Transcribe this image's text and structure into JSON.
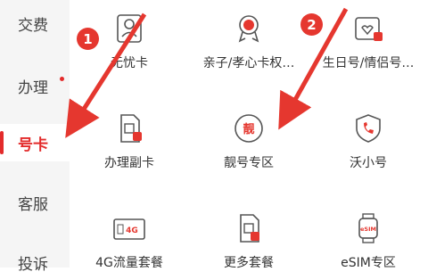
{
  "sidebar": {
    "items": [
      {
        "label": "交费"
      },
      {
        "label": "办理"
      },
      {
        "label": "号卡"
      },
      {
        "label": "客服"
      },
      {
        "label": "投诉"
      }
    ]
  },
  "grid": [
    {
      "label": "无忧卡",
      "icon": "person-card-icon"
    },
    {
      "label": "亲子/孝心卡权…",
      "icon": "family-badge-icon"
    },
    {
      "label": "生日号/情侣号…",
      "icon": "birthday-card-icon"
    },
    {
      "label": "办理副卡",
      "icon": "sim-card-icon"
    },
    {
      "label": "靓号专区",
      "icon": "liang-number-icon",
      "glyph": "靓"
    },
    {
      "label": "沃小号",
      "icon": "phone-shield-icon"
    },
    {
      "label": "4G流量套餐",
      "icon": "4g-data-card-icon",
      "glyph": "4G"
    },
    {
      "label": "更多套餐",
      "icon": "more-plans-card-icon"
    },
    {
      "label": "eSIM专区",
      "icon": "esim-watch-icon",
      "glyph": "eSIM"
    }
  ],
  "annotations": [
    {
      "number": "1"
    },
    {
      "number": "2"
    }
  ],
  "colors": {
    "accent": "#e32b2b",
    "badge": "#e5372f"
  }
}
